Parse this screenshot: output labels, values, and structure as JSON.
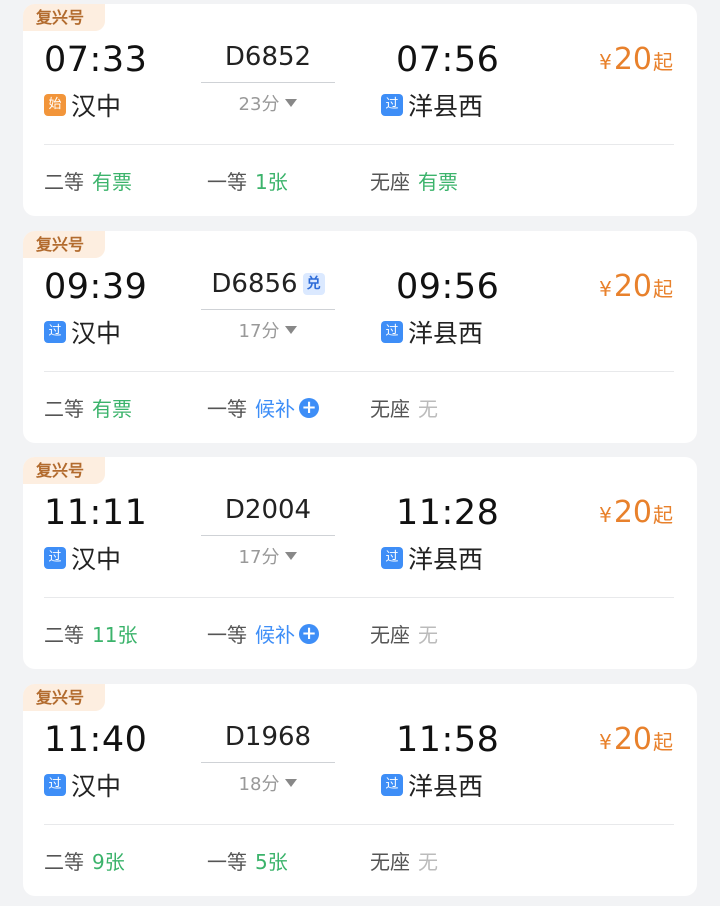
{
  "colors": {
    "accent_orange": "#e8812c",
    "green": "#3bb36b",
    "blue": "#3e8ef7",
    "gray": "#bbbbbb"
  },
  "trains": [
    {
      "badge": "复兴号",
      "dep_time": "07:33",
      "dep_tag": "始",
      "dep_tag_type": "start",
      "dep_station": "汉中",
      "train_no": "D6852",
      "swap_tag": "",
      "duration": "23分",
      "arr_time": "07:56",
      "arr_tag": "过",
      "arr_station": "洋县西",
      "price_symbol": "¥",
      "price": "20",
      "price_suffix": "起",
      "seats": [
        {
          "name": "二等",
          "status": "有票",
          "style": "green",
          "plus": false
        },
        {
          "name": "一等",
          "status": "1张",
          "style": "green",
          "plus": false
        },
        {
          "name": "无座",
          "status": "有票",
          "style": "green",
          "plus": false
        }
      ]
    },
    {
      "badge": "复兴号",
      "dep_time": "09:39",
      "dep_tag": "过",
      "dep_tag_type": "pass",
      "dep_station": "汉中",
      "train_no": "D6856",
      "swap_tag": "兑",
      "duration": "17分",
      "arr_time": "09:56",
      "arr_tag": "过",
      "arr_station": "洋县西",
      "price_symbol": "¥",
      "price": "20",
      "price_suffix": "起",
      "seats": [
        {
          "name": "二等",
          "status": "有票",
          "style": "green",
          "plus": false
        },
        {
          "name": "一等",
          "status": "候补",
          "style": "blue",
          "plus": true
        },
        {
          "name": "无座",
          "status": "无",
          "style": "gray",
          "plus": false
        }
      ]
    },
    {
      "badge": "复兴号",
      "dep_time": "11:11",
      "dep_tag": "过",
      "dep_tag_type": "pass",
      "dep_station": "汉中",
      "train_no": "D2004",
      "swap_tag": "",
      "duration": "17分",
      "arr_time": "11:28",
      "arr_tag": "过",
      "arr_station": "洋县西",
      "price_symbol": "¥",
      "price": "20",
      "price_suffix": "起",
      "seats": [
        {
          "name": "二等",
          "status": "11张",
          "style": "green",
          "plus": false
        },
        {
          "name": "一等",
          "status": "候补",
          "style": "blue",
          "plus": true
        },
        {
          "name": "无座",
          "status": "无",
          "style": "gray",
          "plus": false
        }
      ]
    },
    {
      "badge": "复兴号",
      "dep_time": "11:40",
      "dep_tag": "过",
      "dep_tag_type": "pass",
      "dep_station": "汉中",
      "train_no": "D1968",
      "swap_tag": "",
      "duration": "18分",
      "arr_time": "11:58",
      "arr_tag": "过",
      "arr_station": "洋县西",
      "price_symbol": "¥",
      "price": "20",
      "price_suffix": "起",
      "seats": [
        {
          "name": "二等",
          "status": "9张",
          "style": "green",
          "plus": false
        },
        {
          "name": "一等",
          "status": "5张",
          "style": "green",
          "plus": false
        },
        {
          "name": "无座",
          "status": "无",
          "style": "gray",
          "plus": false
        }
      ]
    }
  ]
}
